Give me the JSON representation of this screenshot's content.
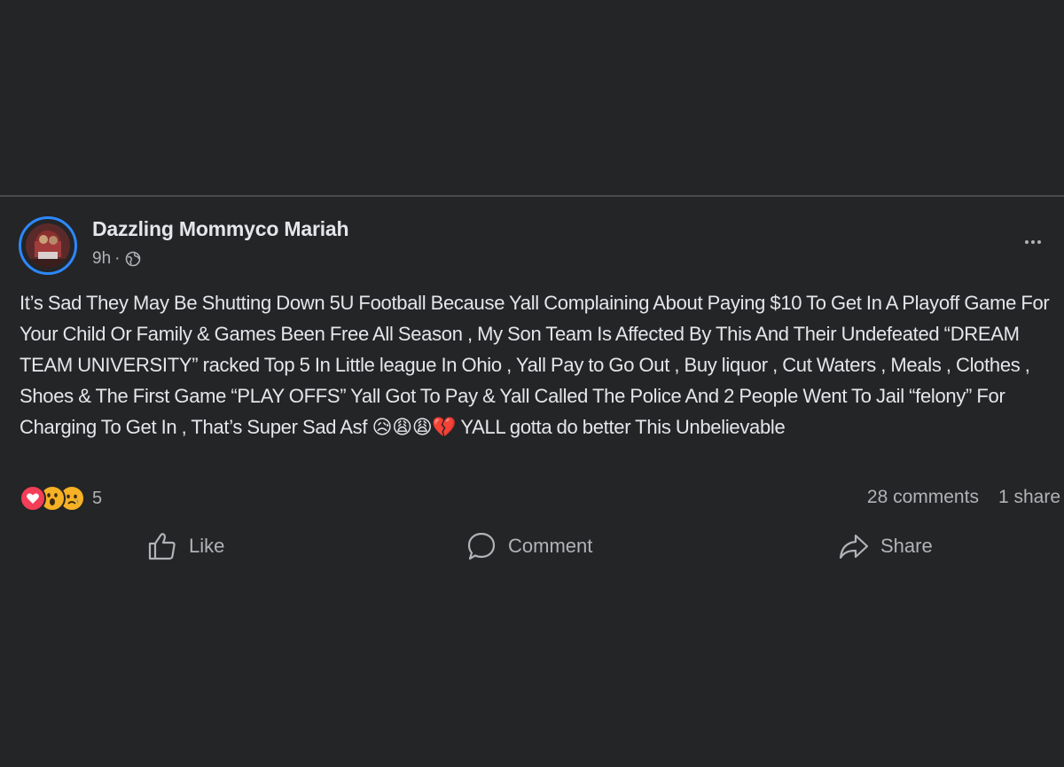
{
  "post": {
    "author": "Dazzling Mommyco Mariah",
    "time": "9h",
    "separator": "·",
    "audience_icon": "globe-icon",
    "text": "It’s Sad They May Be Shutting Down 5U Football Because Yall Complaining About Paying $10 To Get In A Playoff Game For Your  Child Or Family & Games Been Free All Season , My Son Team Is Affected By This And Their Undefeated “DREAM TEAM UNIVERSITY” racked Top 5 In Little league In Ohio , Yall Pay to Go Out , Buy liquor , Cut Waters , Meals , Clothes , Shoes & The First Game “PLAY OFFS” Yall Got To Pay & Yall Called The Police And 2 People Went To Jail “felony” For Charging To Get In , That’s Super Sad Asf 😥😩😩💔 YALL gotta do better This Unbelievable"
  },
  "stats": {
    "reaction_icons": [
      "love-reaction",
      "wow-reaction",
      "sad-reaction"
    ],
    "reaction_count": "5",
    "comments": "28 comments",
    "shares": "1 share"
  },
  "actions": {
    "like": "Like",
    "comment": "Comment",
    "share": "Share"
  },
  "colors": {
    "background": "#242526",
    "text": "#e4e6eb",
    "secondary_text": "#b0b3b8",
    "avatar_ring": "#2d88ff",
    "love": "#f33e58",
    "reaction_yellow": "#f7b125"
  }
}
